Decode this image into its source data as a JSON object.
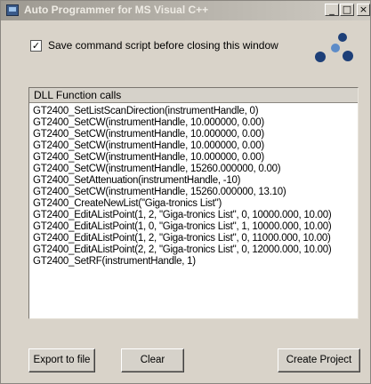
{
  "window": {
    "title": "Auto Programmer for MS Visual C++",
    "min_glyph": "_",
    "max_glyph": "□",
    "close_glyph": "×"
  },
  "checkbox": {
    "label": "Save command script before closing this window",
    "checked": true,
    "check_glyph": "✓"
  },
  "list": {
    "header": "DLL Function calls",
    "lines": [
      "GT2400_SetListScanDirection(instrumentHandle, 0)",
      "GT2400_SetCW(instrumentHandle, 10.000000, 0.00)",
      "GT2400_SetCW(instrumentHandle, 10.000000, 0.00)",
      "GT2400_SetCW(instrumentHandle, 10.000000, 0.00)",
      "GT2400_SetCW(instrumentHandle, 10.000000, 0.00)",
      "GT2400_SetCW(instrumentHandle, 15260.000000, 0.00)",
      "GT2400_SetAttenuation(instrumentHandle, -10)",
      "GT2400_SetCW(instrumentHandle, 15260.000000, 13.10)",
      "GT2400_CreateNewList(\"Giga-tronics List\")",
      "GT2400_EditAListPoint(1, 2, \"Giga-tronics List\", 0, 10000.000, 10.00)",
      "GT2400_EditAListPoint(1, 0, \"Giga-tronics List\", 1, 10000.000, 10.00)",
      "GT2400_EditAListPoint(1, 2, \"Giga-tronics List\", 0, 11000.000, 10.00)",
      "GT2400_EditAListPoint(2, 2, \"Giga-tronics List\", 0, 12000.000, 10.00)",
      "GT2400_SetRF(instrumentHandle, 1)"
    ]
  },
  "buttons": {
    "export": "Export to file",
    "clear": "Clear",
    "create": "Create Project"
  },
  "icons": {
    "app": "app-window-icon",
    "logo": "giga-tronics-dots-logo"
  },
  "colors": {
    "window_bg": "#d9d3c9",
    "logo_blue": "#1d3f78",
    "logo_light": "#5e8cc8"
  }
}
